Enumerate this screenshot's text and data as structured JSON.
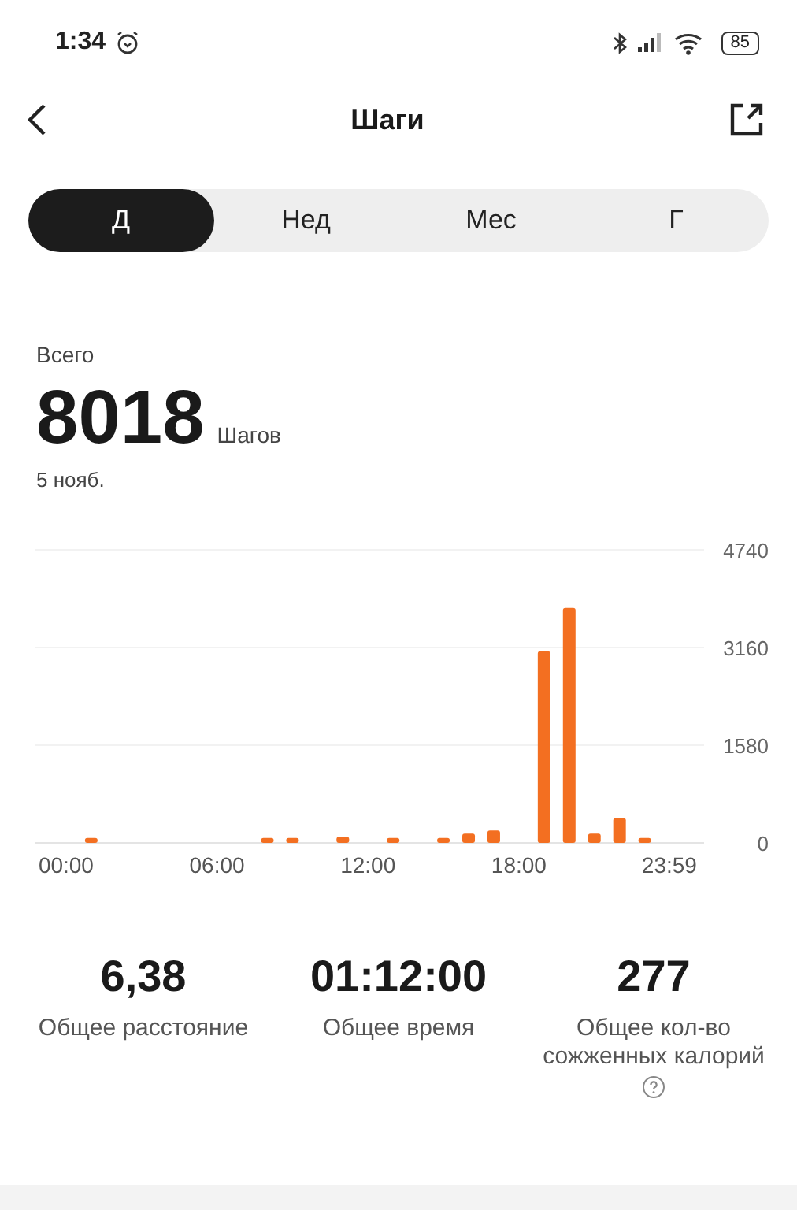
{
  "status_bar": {
    "time": "1:34",
    "battery": "85"
  },
  "header": {
    "title": "Шаги"
  },
  "tabs": [
    {
      "label": "Д",
      "selected": true
    },
    {
      "label": "Нед",
      "selected": false
    },
    {
      "label": "Мес",
      "selected": false
    },
    {
      "label": "Г",
      "selected": false
    }
  ],
  "summary": {
    "label": "Всего",
    "value": "8018",
    "unit": "Шагов",
    "date": "5 нояб."
  },
  "chart_data": {
    "type": "bar",
    "x": [
      1,
      8,
      9,
      11,
      13,
      15,
      16,
      17,
      19,
      20,
      21,
      22,
      23
    ],
    "series": [
      {
        "color": "#f36f21",
        "values": [
          80,
          80,
          80,
          100,
          80,
          80,
          150,
          200,
          3100,
          3800,
          150,
          400,
          80
        ]
      }
    ],
    "xlim": [
      -1.25,
      25.36
    ],
    "ylim": [
      0,
      4740
    ],
    "yticks": [
      0,
      1580,
      3160,
      4740
    ],
    "xticks": [
      {
        "value": 0,
        "label": "00:00"
      },
      {
        "value": 6,
        "label": "06:00"
      },
      {
        "value": 12,
        "label": "12:00"
      },
      {
        "value": 18,
        "label": "18:00"
      },
      {
        "value": 23.98,
        "label": "23:59"
      }
    ]
  },
  "stats": [
    {
      "value": "6,38",
      "label": "Общее расстояние"
    },
    {
      "value": "01:12:00",
      "label": "Общее время"
    },
    {
      "value": "277",
      "label": "Общее кол-во сожженных калорий",
      "help": true
    }
  ]
}
